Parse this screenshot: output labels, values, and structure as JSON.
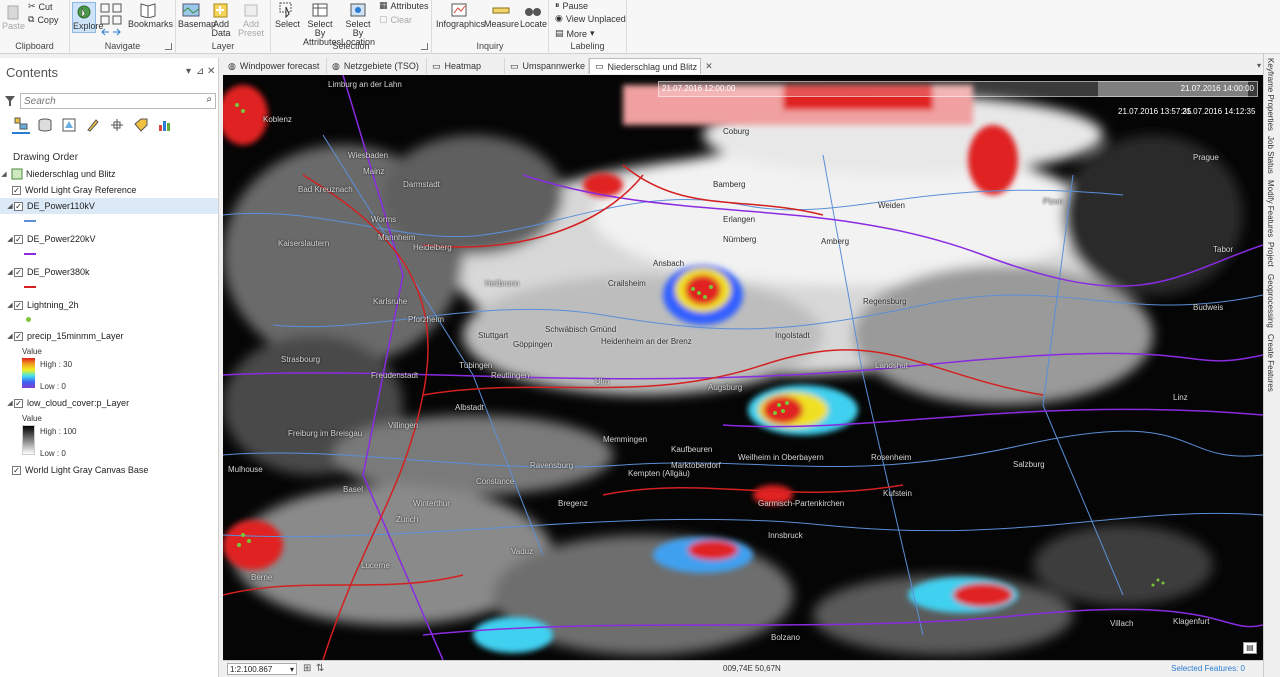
{
  "ribbon": {
    "clipboard": {
      "label": "Clipboard",
      "paste": "Paste",
      "cut": "Cut",
      "copy": "Copy"
    },
    "navigate": {
      "label": "Navigate",
      "explore": "Explore",
      "bookmarks": "Bookmarks"
    },
    "layer": {
      "label": "Layer",
      "basemap": "Basemap",
      "add_data": "Add Data",
      "add_preset": "Add Preset"
    },
    "selection": {
      "label": "Selection",
      "select": "Select",
      "select_by_attributes": "Select By Attributes",
      "select_by_location": "Select By Location",
      "attributes": "Attributes",
      "clear": "Clear"
    },
    "inquiry": {
      "label": "Inquiry",
      "infographics": "Infographics",
      "measure": "Measure",
      "locate": "Locate"
    },
    "labeling": {
      "label": "Labeling",
      "pause": "Pause",
      "view_unplaced": "View Unplaced",
      "more": "More"
    }
  },
  "contents": {
    "title": "Contents",
    "search_placeholder": "Search",
    "drawing_order": "Drawing Order",
    "map_name": "Niederschlag und Blitz",
    "layers": [
      {
        "name": "World Light Gray Reference"
      },
      {
        "name": "DE_Power110kV",
        "color": "#5b8fd8"
      },
      {
        "name": "DE_Power220kV",
        "color": "#8a2be2"
      },
      {
        "name": "DE_Power380k",
        "color": "#d42020"
      },
      {
        "name": "Lightning_2h",
        "color": "#7cc43a"
      },
      {
        "name": "precip_15minmm_Layer"
      },
      {
        "name": "low_cloud_cover:p_Layer"
      },
      {
        "name": "World Light Gray Canvas Base"
      }
    ],
    "precip_legend": {
      "value_label": "Value",
      "high": "High : 30",
      "low": "Low : 0"
    },
    "cloud_legend": {
      "value_label": "Value",
      "high": "High : 100",
      "low": "Low : 0"
    }
  },
  "tabs": [
    {
      "label": "Windpower forecast"
    },
    {
      "label": "Netzgebiete (TSO)"
    },
    {
      "label": "Heatmap"
    },
    {
      "label": "Umspannwerke"
    },
    {
      "label": "Niederschlag und Blitz",
      "active": true
    }
  ],
  "time_slider": {
    "start": "21.07.2016 12:00:00",
    "end": "21.07.2016 14:00:00",
    "current_start": "21.07.2016 13:57:35",
    "current_end": "21.07.2016 14:12:35"
  },
  "map_labels": [
    "Limburg an der Lahn",
    "Koblenz",
    "Wiesbaden",
    "Mainz",
    "Darmstadt",
    "Bad Kreuznach",
    "Worms",
    "Mannheim",
    "Heidelberg",
    "Kaiserslautern",
    "Karlsruhe",
    "Pforzheim",
    "Strasbourg",
    "Stuttgart",
    "Tübingen",
    "Reutlingen",
    "Göppingen",
    "Schwäbisch Gmünd",
    "Heidenheim an der Brenz",
    "Ulm",
    "Augsburg",
    "Ingolstadt",
    "Landshut",
    "Regensburg",
    "Nürnberg",
    "Erlangen",
    "Bamberg",
    "Coburg",
    "Ansbach",
    "Crailsheim",
    "Amberg",
    "Weiden",
    "Prague",
    "Plzen",
    "Tabor",
    "Budweis",
    "Linz",
    "Salzburg",
    "Rosenheim",
    "Kufstein",
    "Innsbruck",
    "Garmisch-Partenkirchen",
    "Weilheim in Oberbayern",
    "Kempten (Allgäu)",
    "Kaufbeuren",
    "Memmingen",
    "Marktoberdorf",
    "Ravensburg",
    "Constance",
    "Bregenz",
    "Vaduz",
    "Zurich",
    "Winterthur",
    "Freiburg im Breisgau",
    "Mulhouse",
    "Basel",
    "Lucerne",
    "Berne",
    "Bolzano",
    "Villach",
    "Klagenfurt",
    "Albstadt",
    "Villingen",
    "Freudenstadt",
    "Heilbronn",
    "Ingolstadt"
  ],
  "status": {
    "scale": "1:2.100.867",
    "coords": "009,74E 50,67N",
    "selected_features": "Selected Features: 0"
  },
  "right_dock": [
    "Keyframe Properties",
    "Job Status",
    "Modify Features",
    "Project",
    "Geoprocessing",
    "Create Features"
  ]
}
